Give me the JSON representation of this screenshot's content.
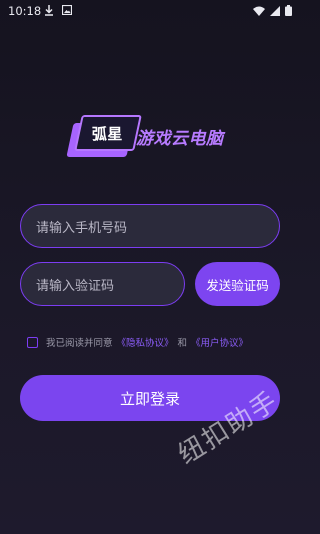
{
  "status_bar": {
    "time": "10:18",
    "left_icons": [
      "download-icon",
      "image-icon"
    ],
    "right_icons": [
      "wifi-icon",
      "signal-icon",
      "battery-icon"
    ]
  },
  "brand": {
    "logo_text": "弧星",
    "app_name": "游戏云电脑",
    "accent_color": "#7c3df2"
  },
  "login_form": {
    "phone_placeholder": "请输入手机号码",
    "code_placeholder": "请输入验证码",
    "send_code_label": "发送验证码",
    "agreement": {
      "prefix": "我已阅读并同意",
      "privacy_link": "《隐私协议》",
      "conjunction": "和",
      "user_link": "《用户协议》",
      "checked": false
    },
    "login_label": "立即登录"
  },
  "watermark": "纽扣助手"
}
